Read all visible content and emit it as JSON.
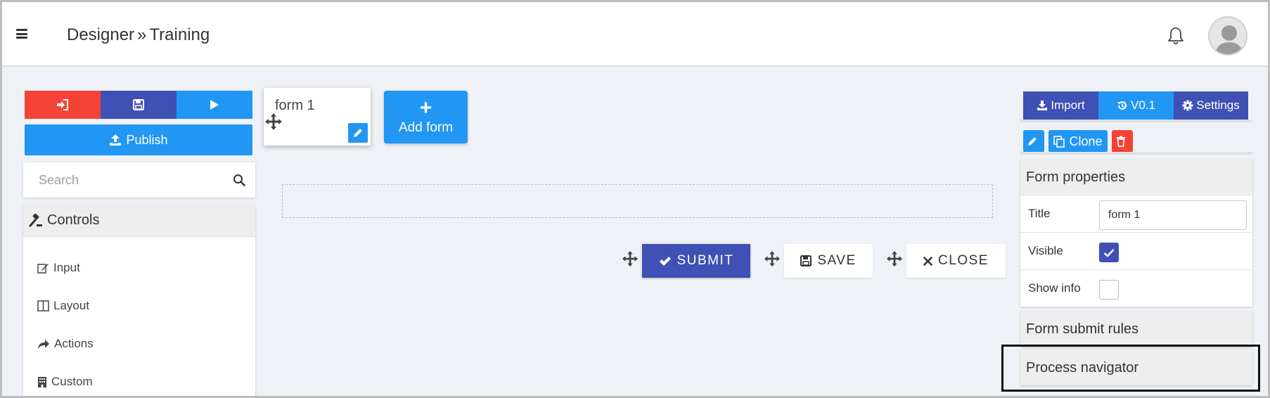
{
  "header": {
    "breadcrumb_root": "Designer",
    "breadcrumb_sep": "»",
    "breadcrumb_current": "Training",
    "icons": [
      "menu-icon",
      "bell-icon",
      "user-avatar"
    ]
  },
  "left_panel": {
    "top_buttons": [
      {
        "icon": "sign-in-icon",
        "color": "#f44336"
      },
      {
        "icon": "save-icon",
        "color": "#3f51b5"
      },
      {
        "icon": "play-icon",
        "color": "#2196f3"
      }
    ],
    "publish_label": "Publish",
    "search_placeholder": "Search",
    "controls_title": "Controls",
    "controls": [
      {
        "label": "Input",
        "icon": "edit-icon"
      },
      {
        "label": "Layout",
        "icon": "columns-icon"
      },
      {
        "label": "Actions",
        "icon": "share-icon"
      },
      {
        "label": "Custom",
        "icon": "building-icon"
      }
    ]
  },
  "canvas": {
    "form_tab_label": "form 1",
    "add_form_label": "Add form",
    "actions": {
      "submit_label": "SUBMIT",
      "save_label": "SAVE",
      "close_label": "CLOSE"
    }
  },
  "right_panel": {
    "import_label": "Import",
    "version_label": "V0.1",
    "settings_label": "Settings",
    "clone_label": "Clone",
    "form_properties": {
      "title": "Form properties",
      "title_label": "Title",
      "title_value": "form 1",
      "visible_label": "Visible",
      "visible_checked": true,
      "show_info_label": "Show info",
      "show_info_checked": false
    },
    "form_submit_rules_title": "Form submit rules",
    "process_navigator_title": "Process navigator"
  },
  "colors": {
    "primary": "#3f51b5",
    "accent": "#2196f3",
    "danger": "#f44336",
    "background": "#eef1f6"
  }
}
